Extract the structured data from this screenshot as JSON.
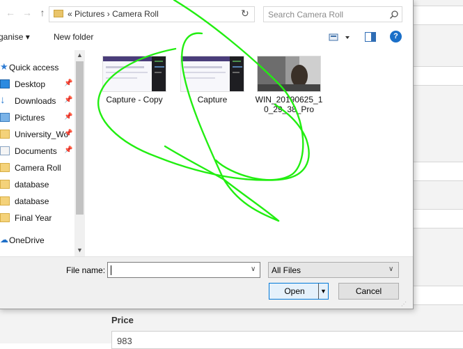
{
  "background_page": {
    "price_label": "Price",
    "price_value": "983"
  },
  "dialog": {
    "address": {
      "breadcrumb_prefix": "«",
      "segments": [
        "Pictures",
        "Camera Roll"
      ],
      "separator": "›"
    },
    "search": {
      "placeholder": "Search Camera Roll"
    },
    "toolbar": {
      "organise_label": "ganise ▾",
      "new_folder_label": "New folder"
    },
    "help_label": "?",
    "sidebar": {
      "items": [
        {
          "label": "Quick access",
          "icon": "star-icon",
          "pinned": false
        },
        {
          "label": "Desktop",
          "icon": "desktop-icon",
          "pinned": true
        },
        {
          "label": "Downloads",
          "icon": "download-icon",
          "pinned": true
        },
        {
          "label": "Pictures",
          "icon": "pictures-icon",
          "pinned": true
        },
        {
          "label": "University_Wo",
          "icon": "folder-icon",
          "pinned": true
        },
        {
          "label": "Documents",
          "icon": "documents-icon",
          "pinned": true
        },
        {
          "label": "Camera Roll",
          "icon": "folder-icon",
          "pinned": false
        },
        {
          "label": "database",
          "icon": "folder-icon",
          "pinned": false
        },
        {
          "label": "database",
          "icon": "folder-icon",
          "pinned": false
        },
        {
          "label": "Final Year",
          "icon": "folder-icon",
          "pinned": false
        },
        {
          "label": "OneDrive",
          "icon": "cloud-icon",
          "pinned": false
        }
      ]
    },
    "files": [
      {
        "name": "Capture - Copy",
        "thumb": "screenshot"
      },
      {
        "name": "Capture",
        "thumb": "screenshot"
      },
      {
        "name": "WIN_20190625_10_29_38_Pro",
        "name_line1": "WIN_20190625_1",
        "name_line2": "0_29_38_Pro",
        "thumb": "photo"
      }
    ],
    "filename": {
      "label": "File name:",
      "value": ""
    },
    "filetype": {
      "value": "All Files"
    },
    "buttons": {
      "open": "Open",
      "cancel": "Cancel"
    }
  },
  "colors": {
    "scribble": "#22ee11",
    "accent": "#0078d7"
  }
}
